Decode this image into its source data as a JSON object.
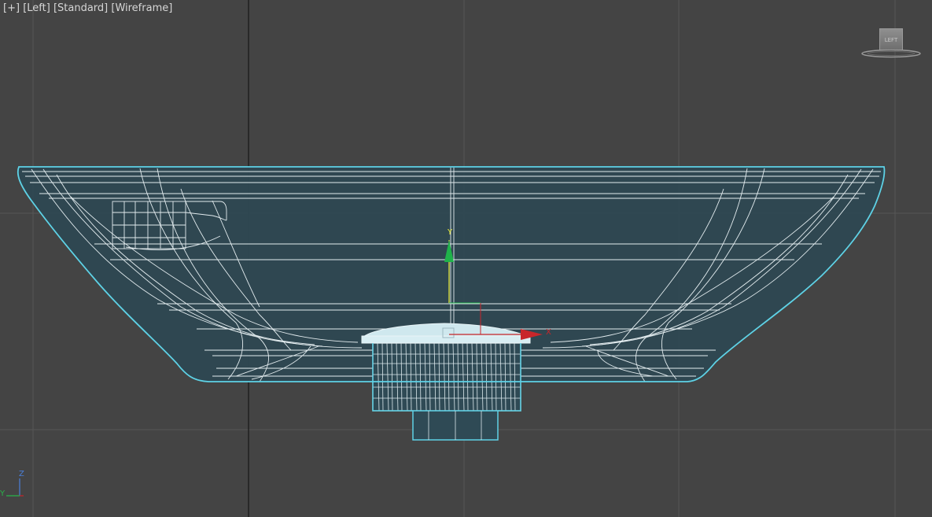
{
  "viewport": {
    "menu_label": "[+]",
    "view_label": "[Left]",
    "shading_label": "[Standard]",
    "display_label": "[Wireframe]"
  },
  "viewcube": {
    "face_label": "LEFT"
  },
  "gizmo": {
    "y_label": "Y",
    "x_label": "X"
  },
  "axis_tripod": {
    "z_label": "Z",
    "y_label": "Y"
  },
  "colors": {
    "background": "#444444",
    "grid": "#575757",
    "grid_axis": "#1a1a1a",
    "wire": "#e6f0f4",
    "selection": "#5ed2e6",
    "fill": "#2f4a55",
    "gizmo_y": "#1fb34a",
    "gizmo_x": "#c8262a"
  }
}
